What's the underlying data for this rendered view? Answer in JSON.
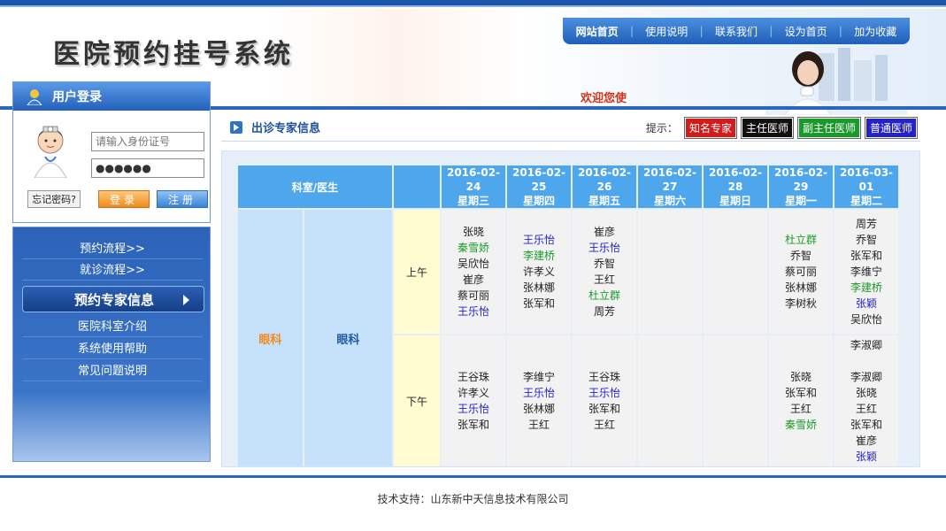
{
  "header": {
    "site_title": "医院预约挂号系统",
    "welcome": "欢迎您使",
    "nav": [
      "网站首页",
      "使用说明",
      "联系我们",
      "设为首页",
      "加为收藏"
    ]
  },
  "login": {
    "title": "用户登录",
    "id_placeholder": "请输入身份证号",
    "password_value": "●●●●●●",
    "forgot_label": "忘记密码?",
    "login_label": "登录",
    "register_label": "注册"
  },
  "menu": {
    "items": [
      "预约流程>>",
      "就诊流程>>"
    ],
    "active": "预约专家信息",
    "items2": [
      "医院科室介绍",
      "系统使用帮助",
      "常见问题说明"
    ]
  },
  "section": {
    "title": "出诊专家信息",
    "hint_label": "提示：",
    "legend": [
      {
        "label": "知名专家",
        "color": "#d41b1b"
      },
      {
        "label": "主任医师",
        "color": "#111111"
      },
      {
        "label": "副主任医师",
        "color": "#1b9a2c"
      },
      {
        "label": "普通医师",
        "color": "#2323c8"
      }
    ]
  },
  "schedule": {
    "header_dept": "科室/医生",
    "dates": [
      {
        "date": "2016-02-24",
        "day": "星期三"
      },
      {
        "date": "2016-02-25",
        "day": "星期四"
      },
      {
        "date": "2016-02-26",
        "day": "星期五"
      },
      {
        "date": "2016-02-27",
        "day": "星期六"
      },
      {
        "date": "2016-02-28",
        "day": "星期日"
      },
      {
        "date": "2016-02-29",
        "day": "星期一"
      },
      {
        "date": "2016-03-01",
        "day": "星期二"
      }
    ],
    "department": "眼科",
    "doctor_group": "眼科",
    "periods": [
      "上午",
      "下午"
    ],
    "morning": [
      [
        {
          "n": "张晓",
          "c": "gray"
        },
        {
          "n": "秦雪娇",
          "c": "green"
        },
        {
          "n": "吴欣怡",
          "c": "gray"
        },
        {
          "n": "崔彦",
          "c": "gray"
        },
        {
          "n": "蔡可丽",
          "c": "gray"
        },
        {
          "n": "王乐怡",
          "c": "blue"
        }
      ],
      [
        {
          "n": "王乐怡",
          "c": "blue"
        },
        {
          "n": "李建桥",
          "c": "green"
        },
        {
          "n": "许孝义",
          "c": "gray"
        },
        {
          "n": "张林娜",
          "c": "gray"
        },
        {
          "n": "张军和",
          "c": "gray"
        }
      ],
      [
        {
          "n": "崔彦",
          "c": "gray"
        },
        {
          "n": "王乐怡",
          "c": "blue"
        },
        {
          "n": "乔智",
          "c": "gray"
        },
        {
          "n": "王红",
          "c": "gray"
        },
        {
          "n": "杜立群",
          "c": "green"
        },
        {
          "n": "周芳",
          "c": "gray"
        }
      ],
      [],
      [],
      [
        {
          "n": "杜立群",
          "c": "green"
        },
        {
          "n": "乔智",
          "c": "gray"
        },
        {
          "n": "蔡可丽",
          "c": "gray"
        },
        {
          "n": "张林娜",
          "c": "gray"
        },
        {
          "n": "李树秋",
          "c": "gray"
        }
      ],
      [
        {
          "n": "周芳",
          "c": "gray"
        },
        {
          "n": "乔智",
          "c": "gray"
        },
        {
          "n": "张军和",
          "c": "gray"
        },
        {
          "n": "李维宁",
          "c": "gray"
        },
        {
          "n": "李建桥",
          "c": "green"
        },
        {
          "n": "张颖",
          "c": "blue"
        },
        {
          "n": "吴欣怡",
          "c": "gray"
        }
      ]
    ],
    "afternoon": [
      [
        {
          "n": "王谷珠",
          "c": "gray"
        },
        {
          "n": "许孝义",
          "c": "gray"
        },
        {
          "n": "王乐怡",
          "c": "blue"
        },
        {
          "n": "张军和",
          "c": "gray"
        }
      ],
      [
        {
          "n": "李维宁",
          "c": "gray"
        },
        {
          "n": "王乐怡",
          "c": "blue"
        },
        {
          "n": "张林娜",
          "c": "gray"
        },
        {
          "n": "王红",
          "c": "gray"
        }
      ],
      [
        {
          "n": "王谷珠",
          "c": "gray"
        },
        {
          "n": "王乐怡",
          "c": "blue"
        },
        {
          "n": "张军和",
          "c": "gray"
        },
        {
          "n": "王红",
          "c": "gray"
        }
      ],
      [],
      [],
      [
        {
          "n": "张晓",
          "c": "gray"
        },
        {
          "n": "张军和",
          "c": "gray"
        },
        {
          "n": "王红",
          "c": "gray"
        },
        {
          "n": "秦雪娇",
          "c": "green"
        }
      ],
      [
        {
          "n": "李淑卿",
          "c": "gray"
        },
        {
          "n": "",
          "c": "gray"
        },
        {
          "n": "李淑卿",
          "c": "gray"
        },
        {
          "n": "张晓",
          "c": "gray"
        },
        {
          "n": "王红",
          "c": "gray"
        },
        {
          "n": "张军和",
          "c": "gray"
        },
        {
          "n": "崔彦",
          "c": "gray"
        },
        {
          "n": "张颖",
          "c": "blue"
        }
      ]
    ]
  },
  "footer": {
    "text": "技术支持：山东新中天信息技术有限公司"
  }
}
